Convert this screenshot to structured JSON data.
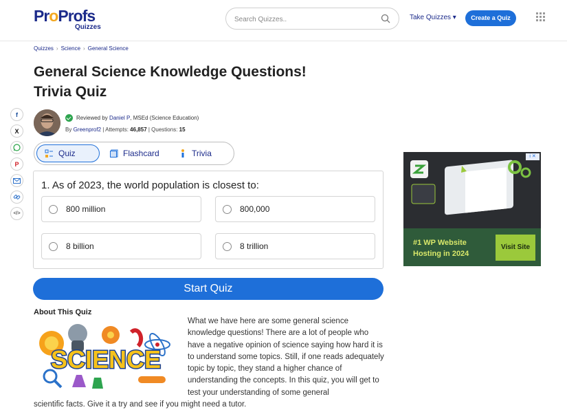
{
  "header": {
    "logo_main_pre": "Pr",
    "logo_main_o": "o",
    "logo_main_post": "Profs",
    "logo_sub": "Quizzes",
    "search_placeholder": "Search Quizzes..",
    "take_quizzes": "Take Quizzes ▾",
    "create_quiz": "Create a Quiz"
  },
  "breadcrumb": [
    "Quizzes",
    "Science",
    "General Science"
  ],
  "breadcrumb_sep": "›",
  "title_line1": "General Science Knowledge Questions!",
  "title_line2": "Trivia Quiz",
  "share_icons": [
    "facebook-icon",
    "x-icon",
    "whatsapp-icon",
    "pinterest-icon",
    "email-icon",
    "link-icon",
    "embed-icon"
  ],
  "share_glyphs": {
    "facebook": "f",
    "x": "X",
    "pinterest": "P",
    "embed": "</>"
  },
  "reviewer": {
    "prefix": "Reviewed by",
    "name": "Daniel P",
    "credentials": ", MSEd (Science Education)"
  },
  "byline": {
    "by": "By",
    "author": "Greenprof2",
    "attempts_label": "| Attempts:",
    "attempts": "46,857",
    "questions_label": "| Questions:",
    "questions": "15"
  },
  "tabs": [
    {
      "label": "Quiz",
      "active": true
    },
    {
      "label": "Flashcard",
      "active": false
    },
    {
      "label": "Trivia",
      "active": false
    }
  ],
  "question": {
    "text": "1. As of 2023, the world population is closest to:",
    "options": [
      "800 million",
      "800,000",
      "8 billion",
      "8 trillion"
    ]
  },
  "start_button": "Start Quiz",
  "about": {
    "heading": "About This Quiz",
    "image_word": "SCIENCE",
    "text_part1": "What we have here are some general science knowledge questions! There are a lot of people who have a negative opinion of science saying how hard it is to understand some topics. Still, if one reads adequately topic by topic, they stand a higher chance of understanding the concepts. In this quiz, you will get to test your understanding of some general",
    "text_part2": "scientific facts. Give it a try and see if you might need a tutor."
  },
  "ad": {
    "text_line1": "#1 WP Website",
    "text_line2": "Hosting in 2024",
    "button": "Visit Site",
    "info_badge": "i ✕"
  },
  "colors": {
    "brand_blue": "#1e6fd9",
    "brand_navy": "#1b2a8a",
    "logo_orange": "#f3a821",
    "ad_accent": "#9bc93b"
  }
}
